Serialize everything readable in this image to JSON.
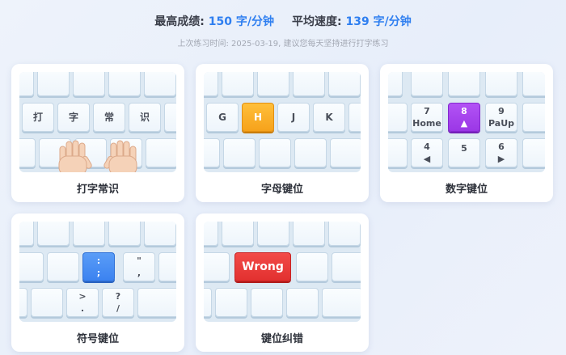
{
  "stats": {
    "best_label": "最高成绩:",
    "best_value": "150 字/分钟",
    "avg_label": "平均速度:",
    "avg_value": "139 字/分钟"
  },
  "hint": "上次练习时间: 2025-03-19, 建议您每天坚持进行打字练习",
  "cards": {
    "basics": {
      "title": "打字常识",
      "keys": [
        "打",
        "字",
        "常",
        "识"
      ],
      "hand_color": "#f5d2b8"
    },
    "letters": {
      "title": "字母键位",
      "keys": [
        "G",
        "H",
        "J",
        "K"
      ],
      "highlight_color": "#f6a21b"
    },
    "numbers": {
      "title": "数字键位",
      "keys": [
        {
          "top": "7",
          "bottom": "Home"
        },
        {
          "top": "8",
          "bottom": "▲"
        },
        {
          "top": "9",
          "bottom": "PaUp"
        },
        {
          "top": "4",
          "bottom": "◀"
        },
        {
          "top": "5",
          "bottom": ""
        },
        {
          "top": "6",
          "bottom": "▶"
        }
      ],
      "highlight_color": "#9b37e6"
    },
    "symbols": {
      "title": "符号键位",
      "keys": [
        {
          "top": ":",
          "bottom": ";"
        },
        {
          "top": "\"",
          "bottom": ","
        },
        {
          "top": ">",
          "bottom": "."
        },
        {
          "top": "?",
          "bottom": "/"
        }
      ],
      "highlight_color": "#3b82f0"
    },
    "correction": {
      "title": "键位纠错",
      "wrong_label": "Wrong",
      "highlight_color": "#e2302f"
    }
  }
}
